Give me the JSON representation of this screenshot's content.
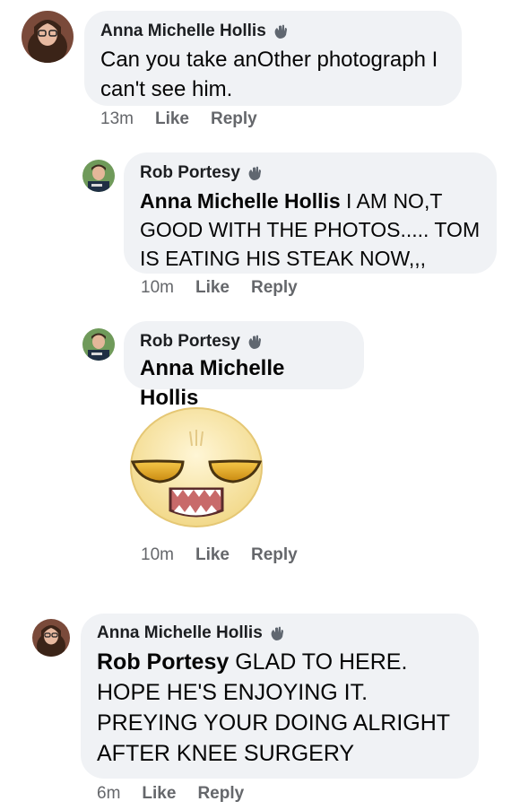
{
  "comments": [
    {
      "author": "Anna Michelle Hollis",
      "text": "Can you take anOther photograph I can't see him.",
      "time": "13m",
      "like": "Like",
      "reply": "Reply"
    },
    {
      "author": "Rob Portesy",
      "mention": "Anna Michelle Hollis",
      "text": " I AM NO,T GOOD WITH THE PHOTOS..... TOM IS EATING HIS STEAK NOW,,,",
      "time": "10m",
      "like": "Like",
      "reply": "Reply"
    },
    {
      "author": "Rob Portesy",
      "mention": "Anna Michelle Hollis",
      "sticker": "smug-face-sticker",
      "time": "10m",
      "like": "Like",
      "reply": "Reply"
    },
    {
      "author": "Anna Michelle Hollis",
      "mention": "Rob Portesy",
      "text": " GLAD TO HERE. HOPE HE'S ENJOYING IT. PREYING YOUR DOING ALRIGHT AFTER KNEE SURGERY",
      "time": "6m",
      "like": "Like",
      "reply": "Reply"
    }
  ],
  "colors": {
    "bubble": "#f0f2f5",
    "meta": "#65676b",
    "text": "#050505"
  }
}
